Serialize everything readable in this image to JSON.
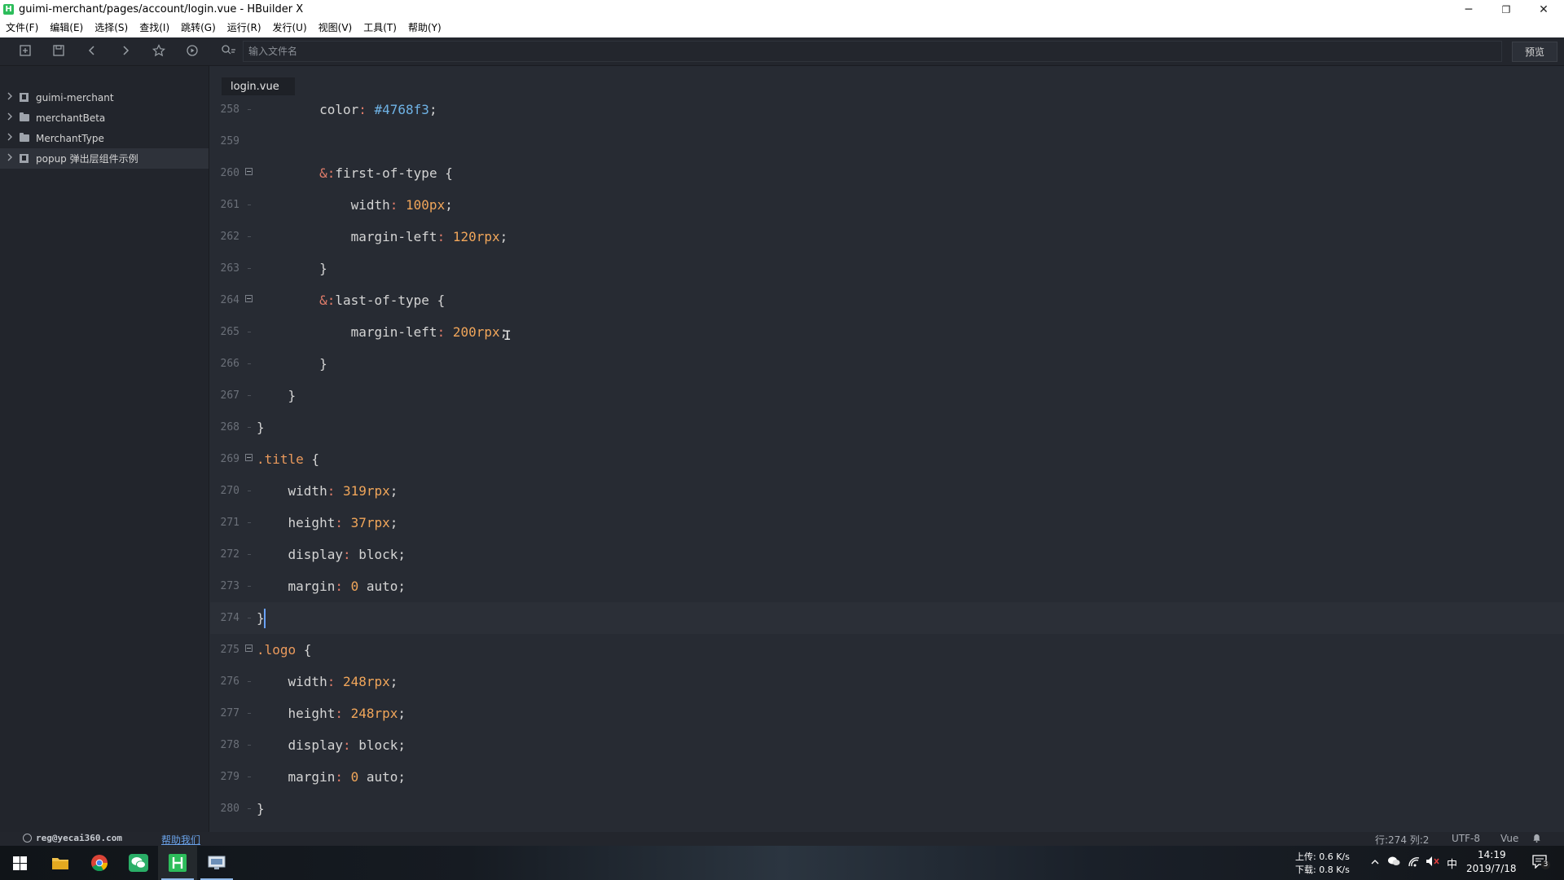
{
  "window": {
    "title": "guimi-merchant/pages/account/login.vue - HBuilder X",
    "app_icon_letter": "H",
    "minimize_glyph": "─",
    "restore_glyph": "❐",
    "close_glyph": "✕"
  },
  "menu": {
    "items": [
      "文件(F)",
      "编辑(E)",
      "选择(S)",
      "查找(I)",
      "跳转(G)",
      "运行(R)",
      "发行(U)",
      "视图(V)",
      "工具(T)",
      "帮助(Y)"
    ]
  },
  "toolbar": {
    "search_placeholder": "输入文件名",
    "preview_label": "预览",
    "icons": [
      "new-file-icon",
      "save-icon",
      "back-icon",
      "forward-icon",
      "star-icon",
      "run-icon",
      "file-search-icon"
    ]
  },
  "sidebar": {
    "items": [
      {
        "label": "guimi-merchant",
        "icon": "project-icon",
        "selected": false
      },
      {
        "label": "merchantBeta",
        "icon": "folder-icon",
        "selected": false
      },
      {
        "label": "MerchantType",
        "icon": "folder-icon",
        "selected": false
      },
      {
        "label": "popup 弹出层组件示例",
        "icon": "project-icon",
        "selected": true
      }
    ]
  },
  "tabs": [
    {
      "label": "login.vue",
      "active": true
    }
  ],
  "editor": {
    "current_line": 274,
    "lines": [
      {
        "no": "258",
        "tokens": [
          [
            "tk-prop",
            "        color"
          ],
          [
            "tk-colon",
            ": "
          ],
          [
            "tk-hex",
            "#4768f3"
          ],
          [
            "tk-plain",
            ";"
          ]
        ]
      },
      {
        "no": "259",
        "tokens": []
      },
      {
        "no": "260",
        "fold": true,
        "tokens": [
          [
            "tk-amp",
            "        &"
          ],
          [
            "tk-colon",
            ":"
          ],
          [
            "tk-plain",
            "first-of-type {"
          ]
        ]
      },
      {
        "no": "261",
        "tokens": [
          [
            "tk-prop",
            "            width"
          ],
          [
            "tk-colon",
            ": "
          ],
          [
            "tk-num",
            "100px"
          ],
          [
            "tk-plain",
            ";"
          ]
        ]
      },
      {
        "no": "262",
        "tokens": [
          [
            "tk-prop",
            "            margin-left"
          ],
          [
            "tk-colon",
            ": "
          ],
          [
            "tk-num",
            "120rpx"
          ],
          [
            "tk-plain",
            ";"
          ]
        ]
      },
      {
        "no": "263",
        "tokens": [
          [
            "tk-plain",
            "        }"
          ]
        ]
      },
      {
        "no": "264",
        "fold": true,
        "tokens": [
          [
            "tk-amp",
            "        &"
          ],
          [
            "tk-colon",
            ":"
          ],
          [
            "tk-plain",
            "last-of-type {"
          ]
        ]
      },
      {
        "no": "265",
        "tokens": [
          [
            "tk-prop",
            "            margin-left"
          ],
          [
            "tk-colon",
            ": "
          ],
          [
            "tk-num",
            "200rpx"
          ],
          [
            "tk-plain",
            ";"
          ]
        ]
      },
      {
        "no": "266",
        "tokens": [
          [
            "tk-plain",
            "        }"
          ]
        ]
      },
      {
        "no": "267",
        "tokens": [
          [
            "tk-plain",
            "    }"
          ]
        ]
      },
      {
        "no": "268",
        "tokens": [
          [
            "tk-plain",
            "}"
          ]
        ]
      },
      {
        "no": "269",
        "fold": true,
        "tokens": [
          [
            "tk-class",
            ".title"
          ],
          [
            "tk-plain",
            " {"
          ]
        ]
      },
      {
        "no": "270",
        "tokens": [
          [
            "tk-prop",
            "    width"
          ],
          [
            "tk-colon",
            ": "
          ],
          [
            "tk-num",
            "319rpx"
          ],
          [
            "tk-plain",
            ";"
          ]
        ]
      },
      {
        "no": "271",
        "tokens": [
          [
            "tk-prop",
            "    height"
          ],
          [
            "tk-colon",
            ": "
          ],
          [
            "tk-num",
            "37rpx"
          ],
          [
            "tk-plain",
            ";"
          ]
        ]
      },
      {
        "no": "272",
        "tokens": [
          [
            "tk-prop",
            "    display"
          ],
          [
            "tk-colon",
            ": "
          ],
          [
            "tk-plain",
            "block;"
          ]
        ]
      },
      {
        "no": "273",
        "tokens": [
          [
            "tk-prop",
            "    margin"
          ],
          [
            "tk-colon",
            ": "
          ],
          [
            "tk-num",
            "0"
          ],
          [
            "tk-plain",
            " auto;"
          ]
        ]
      },
      {
        "no": "274",
        "tokens": [
          [
            "tk-plain",
            "}"
          ]
        ]
      },
      {
        "no": "275",
        "fold": true,
        "tokens": [
          [
            "tk-class",
            ".logo"
          ],
          [
            "tk-plain",
            " {"
          ]
        ]
      },
      {
        "no": "276",
        "tokens": [
          [
            "tk-prop",
            "    width"
          ],
          [
            "tk-colon",
            ": "
          ],
          [
            "tk-num",
            "248rpx"
          ],
          [
            "tk-plain",
            ";"
          ]
        ]
      },
      {
        "no": "277",
        "tokens": [
          [
            "tk-prop",
            "    height"
          ],
          [
            "tk-colon",
            ": "
          ],
          [
            "tk-num",
            "248rpx"
          ],
          [
            "tk-plain",
            ";"
          ]
        ]
      },
      {
        "no": "278",
        "tokens": [
          [
            "tk-prop",
            "    display"
          ],
          [
            "tk-colon",
            ": "
          ],
          [
            "tk-plain",
            "block;"
          ]
        ]
      },
      {
        "no": "279",
        "tokens": [
          [
            "tk-prop",
            "    margin"
          ],
          [
            "tk-colon",
            ": "
          ],
          [
            "tk-num",
            "0"
          ],
          [
            "tk-plain",
            " auto;"
          ]
        ]
      },
      {
        "no": "280",
        "tokens": [
          [
            "tk-plain",
            "}"
          ]
        ]
      }
    ]
  },
  "status": {
    "email": "reg@yecai360.com",
    "help_link": "帮助我们",
    "position": "行:274  列:2",
    "encoding": "UTF-8",
    "language": "Vue"
  },
  "taskbar": {
    "apps": [
      "windows-start-icon",
      "file-explorer-icon",
      "chrome-icon",
      "wechat-icon",
      "hbuilder-icon",
      "desktop-app-icon"
    ],
    "net_up": "上传: 0.6 K/s",
    "net_down": "下载: 0.8 K/s",
    "ime": "中",
    "time": "14:19",
    "date": "2019/7/18",
    "notification_count": "3"
  }
}
